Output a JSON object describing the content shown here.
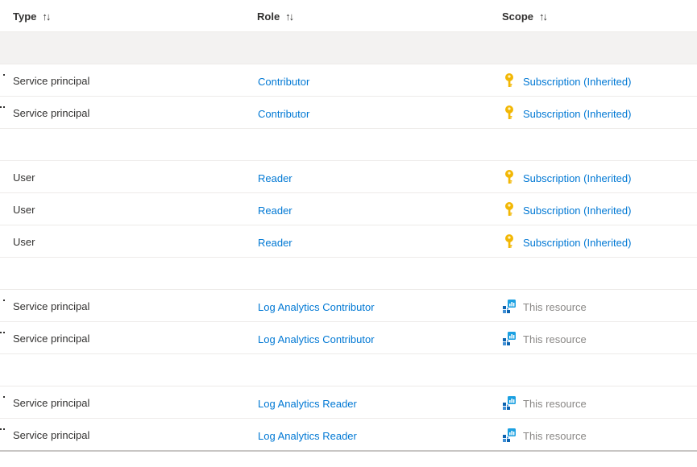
{
  "columns": {
    "type": "Type",
    "role": "Role",
    "scope": "Scope",
    "sort_glyph": "↑↓"
  },
  "groups": [
    {
      "rows": [
        {
          "type": "Service principal",
          "role": "Contributor",
          "scope": "Subscription (Inherited)",
          "scope_icon": "key-icon",
          "marker": "single"
        },
        {
          "type": "Service principal",
          "role": "Contributor",
          "scope": "Subscription (Inherited)",
          "scope_icon": "key-icon",
          "marker": "double"
        }
      ]
    },
    {
      "rows": [
        {
          "type": "User",
          "role": "Reader",
          "scope": "Subscription (Inherited)",
          "scope_icon": "key-icon",
          "marker": "none"
        },
        {
          "type": "User",
          "role": "Reader",
          "scope": "Subscription (Inherited)",
          "scope_icon": "key-icon",
          "marker": "none"
        },
        {
          "type": "User",
          "role": "Reader",
          "scope": "Subscription (Inherited)",
          "scope_icon": "key-icon",
          "marker": "none"
        }
      ]
    },
    {
      "rows": [
        {
          "type": "Service principal",
          "role": "Log Analytics Contributor",
          "scope": "This resource",
          "scope_icon": "log-analytics-workspace-icon",
          "marker": "single"
        },
        {
          "type": "Service principal",
          "role": "Log Analytics Contributor",
          "scope": "This resource",
          "scope_icon": "log-analytics-workspace-icon",
          "marker": "double"
        }
      ]
    },
    {
      "rows": [
        {
          "type": "Service principal",
          "role": "Log Analytics Reader",
          "scope": "This resource",
          "scope_icon": "log-analytics-workspace-icon",
          "marker": "single"
        },
        {
          "type": "Service principal",
          "role": "Log Analytics Reader",
          "scope": "This resource",
          "scope_icon": "log-analytics-workspace-icon",
          "marker": "double"
        }
      ]
    }
  ],
  "colors": {
    "link": "#0078d4",
    "muted": "#8a8886",
    "key": "#f2b705",
    "group_header_bg": "#f3f2f1"
  }
}
